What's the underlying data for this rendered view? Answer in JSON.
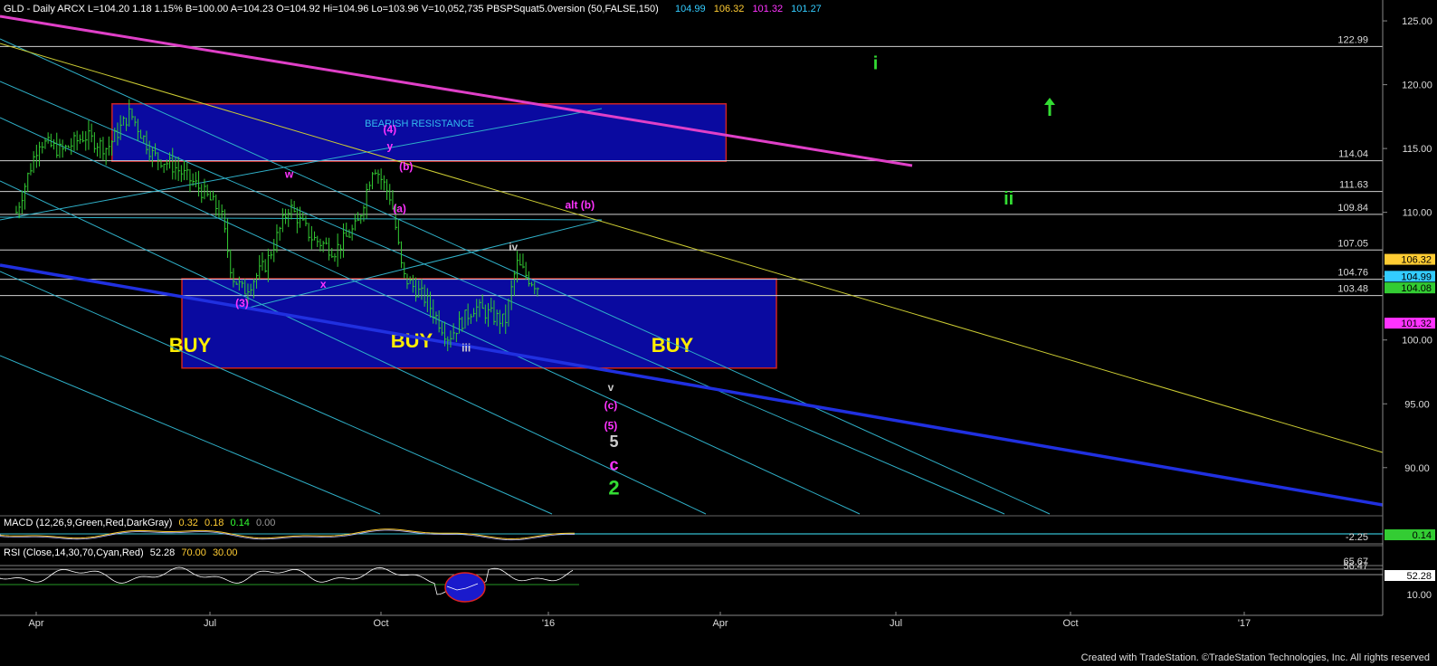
{
  "header": {
    "main": "GLD - Daily  ARCX  L=104.20  1.18  1.15%  B=100.00  A=104.23  O=104.92  Hi=104.96  Lo=103.96  V=10,052,735  PBSPSquat5.0version (50,FALSE,150)",
    "ind_values": [
      "104.99",
      "106.32",
      "101.32",
      "101.27"
    ],
    "ind_colors": [
      "#33ccff",
      "#ffcc33",
      "#ff33ff",
      "#33ccff"
    ],
    "macd": "MACD (12,26,9,Green,Red,DarkGray)",
    "macd_values": [
      "0.32",
      "0.18",
      "0.14",
      "0.00"
    ],
    "macd_colors": [
      "#ffcc33",
      "#ffcc33",
      "#33ff33",
      "#999999"
    ],
    "rsi": "RSI (Close,14,30,70,Cyan,Red)",
    "rsi_values": [
      "52.28",
      "70.00",
      "30.00"
    ],
    "rsi_colors": [
      "#ffffff",
      "#ffcc33",
      "#ffcc33"
    ]
  },
  "footer": "Created with TradeStation. ©TradeStation Technologies, Inc. All rights reserved",
  "colors": {
    "background": "#000000",
    "bars": "#33cc33",
    "box": "#0a0aa0",
    "box_border": "#cc2222",
    "magenta": "#e040c8",
    "channel": "#2fb0c8",
    "yellow": "#cccc33",
    "blue_line": "#2030e0",
    "green_label": "#33dd33",
    "buy_text": "#ffee00"
  },
  "chart_data": {
    "type": "line",
    "title": "GLD - Daily",
    "xlabel": "",
    "ylabel": "",
    "ylim": [
      88,
      125.5
    ],
    "x_ticks": [
      "Apr",
      "Jul",
      "Oct",
      "'16",
      "Apr",
      "Jul",
      "Oct",
      "'17"
    ],
    "y_ticks": [
      "125.00",
      "120.00",
      "115.00",
      "110.00",
      "105.00",
      "100.00",
      "95.00",
      "90.00"
    ],
    "grid": false,
    "series": [
      {
        "name": "Close",
        "x": [
          "2015-03-10",
          "2015-03-24",
          "2015-04-07",
          "2015-04-21",
          "2015-05-05",
          "2015-05-19",
          "2015-06-02",
          "2015-06-16",
          "2015-06-30",
          "2015-07-14",
          "2015-07-21",
          "2015-07-28",
          "2015-08-11",
          "2015-08-25",
          "2015-09-08",
          "2015-09-22",
          "2015-10-06",
          "2015-10-16",
          "2015-10-27",
          "2015-11-03",
          "2015-11-17",
          "2015-12-01",
          "2015-12-17",
          "2016-01-05",
          "2016-01-12",
          "2016-01-19",
          "2016-01-25"
        ],
        "values": [
          110,
          115.6,
          114.8,
          116,
          115,
          117.8,
          114.5,
          113.5,
          112,
          110,
          105,
          103.8,
          106,
          110.5,
          108,
          107,
          109,
          113.8,
          111,
          105,
          103.2,
          100.2,
          102.6,
          101.4,
          106,
          104.9,
          104.2
        ]
      }
    ],
    "horizontal_levels": [
      {
        "label": "122.99",
        "value": 122.99
      },
      {
        "label": "114.04",
        "value": 114.04
      },
      {
        "label": "111.63",
        "value": 111.63
      },
      {
        "label": "109.84",
        "value": 109.84
      },
      {
        "label": "107.05",
        "value": 107.05
      },
      {
        "label": "104.76",
        "value": 104.76
      },
      {
        "label": "103.48",
        "value": 103.48
      }
    ],
    "price_tags": [
      {
        "label": "106.32",
        "value": 106.32,
        "color": "#ffcc33",
        "text": "#000000"
      },
      {
        "label": "104.99",
        "value": 104.99,
        "color": "#33ccff",
        "text": "#000000"
      },
      {
        "label": "104.08",
        "value": 104.08,
        "color": "#33cc33",
        "text": "#000000"
      },
      {
        "label": "101.32",
        "value": 101.32,
        "color": "#ff33ff",
        "text": "#000000"
      }
    ],
    "zones": [
      {
        "label": "BEARISH RESISTANCE",
        "x0": "2015-05-08",
        "x1": "2016-05-20",
        "y0": 114.0,
        "y1": 118.5
      },
      {
        "label": "BUY",
        "x0": "2015-06-20",
        "x1": "2016-06-20",
        "y0": 97.8,
        "y1": 104.8,
        "texts": [
          "BUY",
          "BUY",
          "BUY"
        ]
      }
    ],
    "wave_labels": [
      {
        "text": "w",
        "x": "2015-08-25",
        "y": 112.7,
        "color": "#ff33ff"
      },
      {
        "text": "x",
        "x": "2015-09-15",
        "y": 104.1,
        "color": "#ff33ff"
      },
      {
        "text": "(3)",
        "x": "2015-07-27",
        "y": 102.6,
        "color": "#ff33ff"
      },
      {
        "text": "(4)",
        "x": "2015-10-26",
        "y": 116.2,
        "color": "#ff33ff"
      },
      {
        "text": "y",
        "x": "2015-10-26",
        "y": 114.9,
        "color": "#ff33ff"
      },
      {
        "text": "(b)",
        "x": "2015-11-05",
        "y": 113.3,
        "color": "#ff33ff"
      },
      {
        "text": "(a)",
        "x": "2015-11-01",
        "y": 110.0,
        "color": "#ff33ff"
      },
      {
        "text": "alt (b)",
        "x": "2016-02-20",
        "y": 110.3,
        "color": "#ff33ff"
      },
      {
        "text": "iv",
        "x": "2016-01-10",
        "y": 107.0,
        "color": "#cccccc"
      },
      {
        "text": "iii",
        "x": "2015-12-12",
        "y": 99.1,
        "color": "#cccccc"
      },
      {
        "text": "v",
        "x": "2016-03-10",
        "y": 96.0,
        "color": "#cccccc"
      },
      {
        "text": "(c)",
        "x": "2016-03-10",
        "y": 94.6,
        "color": "#ff33ff"
      },
      {
        "text": "(5)",
        "x": "2016-03-10",
        "y": 93.0,
        "color": "#ff33ff"
      },
      {
        "text": "5",
        "x": "2016-03-12",
        "y": 91.6,
        "color": "#cccccc"
      },
      {
        "text": "c",
        "x": "2016-03-12",
        "y": 89.8,
        "color": "#ff33ff"
      },
      {
        "text": "2",
        "x": "2016-03-12",
        "y": 87.9,
        "color": "#33dd33"
      },
      {
        "text": "i",
        "x": "2016-08-20",
        "y": 121.2,
        "color": "#33dd33"
      },
      {
        "text": "ii",
        "x": "2016-11-10",
        "y": 110.6,
        "color": "#33dd33"
      }
    ],
    "macd": {
      "label": "-2.25",
      "value": -2.25,
      "tag": "0.14"
    },
    "rsi": {
      "value": 52.28,
      "levels": [
        "65.67",
        "56.47",
        "52.28",
        "10.00"
      ]
    }
  }
}
